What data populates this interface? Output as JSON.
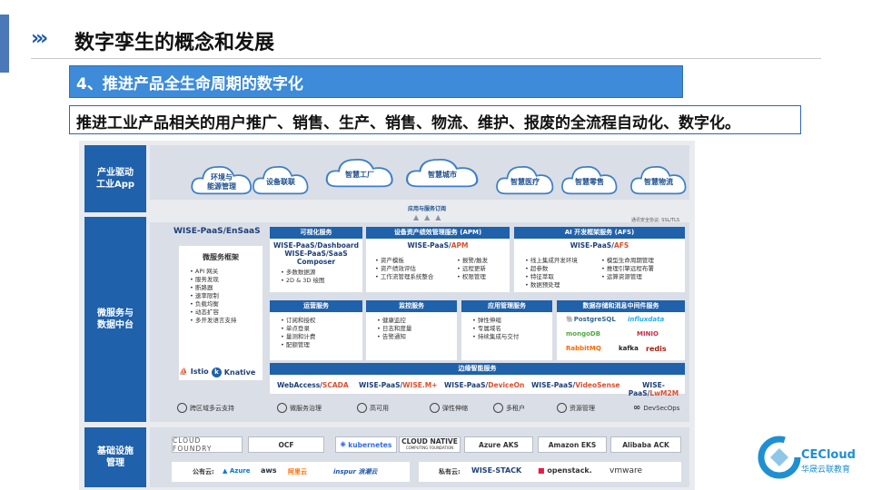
{
  "page": {
    "title": "数字孪生的概念和发展",
    "chevrons": "›››"
  },
  "section": {
    "title": "4、推进产品全生命周期的数字化",
    "summary": "推进工业产品相关的用户推广、销售、生产、销售、物流、维护、报废的全流程自动化、数字化。"
  },
  "diagram": {
    "bands": {
      "top": "产业驱动\n工业App",
      "mid": "微服务与\n数据中台",
      "bottom": "基础设施\n管理"
    },
    "clouds": [
      "环境与\n能源管理",
      "设备联联",
      "智慧工厂",
      "智慧城市",
      "智慧医疗",
      "智慧零售",
      "智慧物流"
    ],
    "api_label": "应用与服务订阅",
    "security_label": "通讯安全协议: SSL/TLS",
    "ensaas": {
      "title": "WISE-PaaS/EnSaaS",
      "framework": "微服务框架",
      "items": [
        "API 网关",
        "服务发现",
        "断路器",
        "速率限制",
        "负载均衡",
        "动态扩容",
        "多开发语言支持"
      ],
      "istio": "Istio",
      "knative": "Knative"
    },
    "viz": {
      "head": "可视化服务",
      "p1": "WISE-PaaS/Dashboard",
      "p2": "WISE-PaaS/SaaS Composer",
      "items": [
        "多数数据源",
        "2D & 3D 绘图"
      ]
    },
    "apm": {
      "head": "设备资产绩效管理服务 (APM)",
      "p1": "WISE-PaaS/",
      "p1acc": "APM",
      "col1": [
        "资产模板",
        "资产绩效评估",
        "工作流管理系统整合"
      ],
      "col2": [
        "报警/触发",
        "远程更新",
        "权限管理"
      ]
    },
    "afs": {
      "head": "AI 开发框架服务 (AFS)",
      "p1": "WISE-PaaS/",
      "p1acc": "AFS",
      "col1": [
        "线上集成开发环境",
        "超参数",
        "特征萃取",
        "数据预处理"
      ],
      "col2": [
        "模型生命周期管理",
        "推理引擎远程布署",
        "运算资源管理"
      ]
    },
    "ops": {
      "head": "运营服务",
      "items": [
        "订阅和授权",
        "单点登录",
        "量测和计费",
        "配额管理"
      ]
    },
    "monitor": {
      "head": "监控服务",
      "items": [
        "健康监控",
        "日志和度量",
        "告警通知"
      ]
    },
    "appsvc": {
      "head": "应用管理服务",
      "items": [
        "弹性伸缩",
        "专属域名",
        "持续集成与交付"
      ]
    },
    "data": {
      "head": "数据存储和消息中间件服务",
      "logos": [
        "PostgreSQL",
        "influxdata",
        "mongoDB",
        "MINIO",
        "RabbitMQ",
        "kafka",
        "redis"
      ]
    },
    "edge": {
      "head": "边缘智能服务",
      "products": [
        {
          "a": "WebAccess/",
          "b": "SCADA"
        },
        {
          "a": "WISE-PaaS/",
          "b": "WISE.M+"
        },
        {
          "a": "WISE-PaaS/",
          "b": "DeviceOn"
        },
        {
          "a": "WISE-PaaS/",
          "b": "VideoSense"
        },
        {
          "a": "WISE-PaaS/",
          "b": "LwM2M"
        }
      ]
    },
    "features": [
      "跨区域多云支持",
      "微服务治理",
      "高可用",
      "弹性伸缩",
      "多租户",
      "资源管理",
      "DevSecOps"
    ],
    "infra": {
      "row1": [
        "CLOUD FOUNDRY",
        "OCF",
        "kubernetes",
        "CLOUD NATIVE",
        "Azure AKS",
        "Amazon EKS",
        "Alibaba ACK"
      ],
      "cncf_sub": "COMPUTING FOUNDATION",
      "public_label": "公有云:",
      "public": [
        "Azure",
        "aws",
        "阿里云",
        "inspur 浪潮云"
      ],
      "private_label": "私有云:",
      "private": [
        "WISE-STACK",
        "openstack.",
        "vmware"
      ]
    }
  },
  "brand": {
    "name": "CECloud",
    "sub": "华晟云联教育"
  },
  "colors": {
    "accent": "#1f61ab",
    "band": "#3d8bd9",
    "brand": "#1e8fd2"
  }
}
